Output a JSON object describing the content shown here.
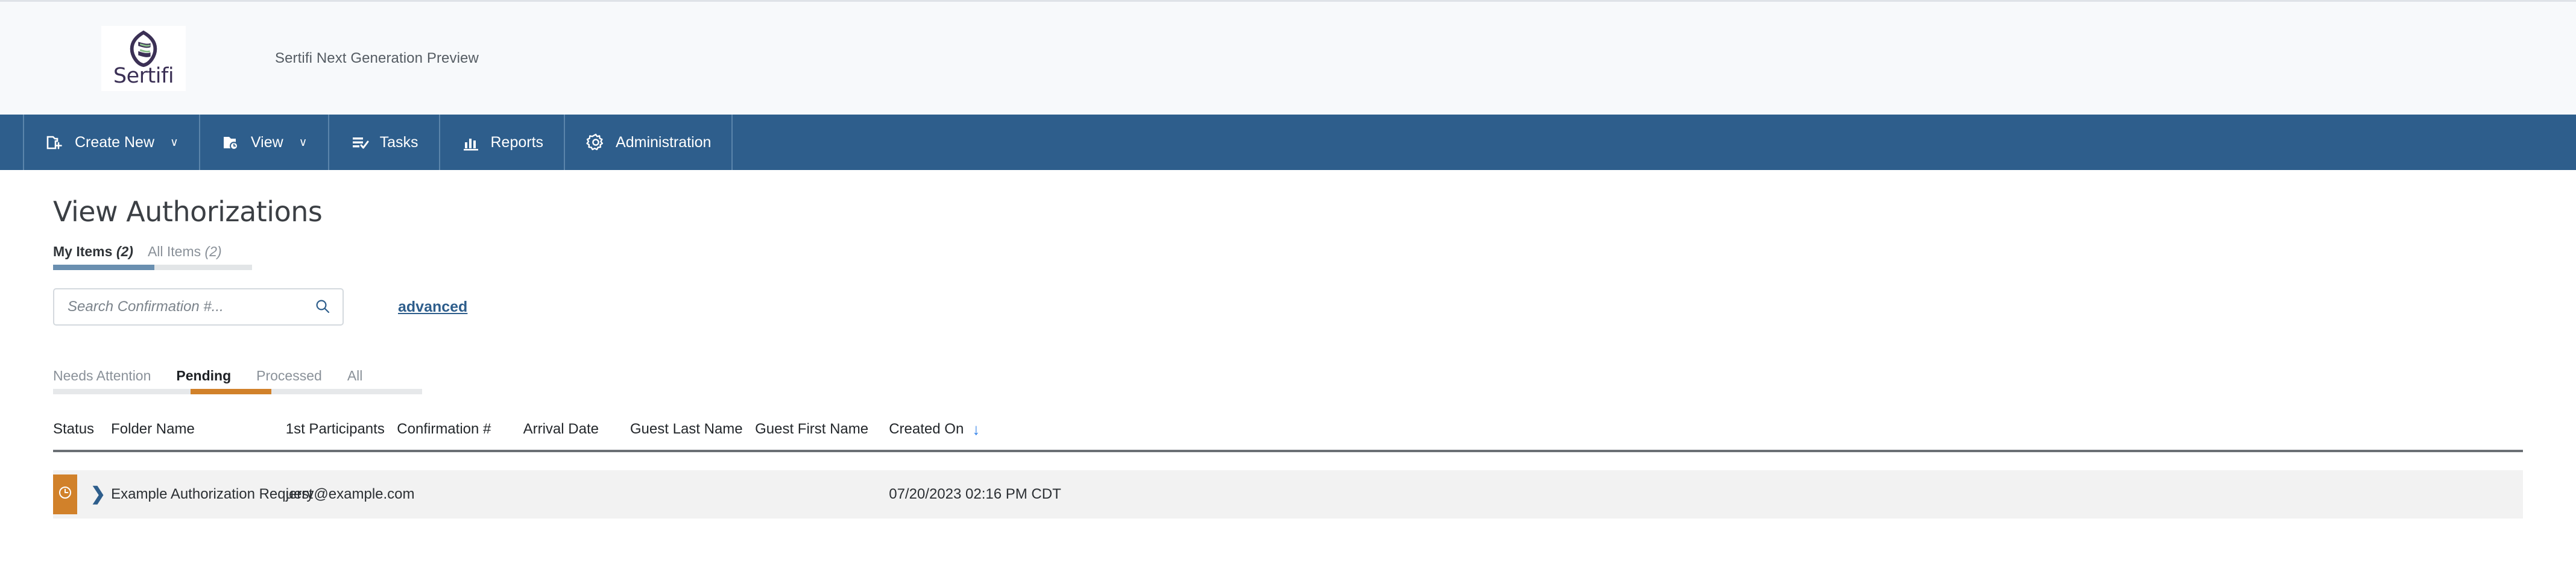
{
  "brand": {
    "logo_word": "Sertifi",
    "logo_icon": "sertifi-leaf-logo",
    "preview_text": "Sertifi Next Generation Preview"
  },
  "nav": {
    "items": [
      {
        "label": "Create New",
        "icon": "folder-plus-icon",
        "caret": "∨",
        "has_caret": true
      },
      {
        "label": "View",
        "icon": "folder-clock-icon",
        "caret": "∨",
        "has_caret": true
      },
      {
        "label": "Tasks",
        "icon": "list-check-icon",
        "has_caret": false
      },
      {
        "label": "Reports",
        "icon": "bar-chart-icon",
        "has_caret": false
      },
      {
        "label": "Administration",
        "icon": "gear-icon",
        "has_caret": false
      }
    ]
  },
  "page": {
    "title": "View Authorizations"
  },
  "scope_tabs": [
    {
      "label": "My Items",
      "count": "(2)",
      "active": true
    },
    {
      "label": "All Items",
      "count": "(2)",
      "active": false
    }
  ],
  "search": {
    "value": "",
    "placeholder": "Search Confirmation #...",
    "icon": "search-icon",
    "advanced_label": "advanced"
  },
  "filter_tabs": [
    {
      "label": "Needs Attention",
      "active": false
    },
    {
      "label": "Pending",
      "active": true
    },
    {
      "label": "Processed",
      "active": false
    },
    {
      "label": "All",
      "active": false
    }
  ],
  "table": {
    "columns": [
      {
        "label": "Status",
        "sorted": false
      },
      {
        "label": "Folder Name",
        "sorted": false
      },
      {
        "label": "1st Participants",
        "sorted": false
      },
      {
        "label": "Confirmation #",
        "sorted": false
      },
      {
        "label": "Arrival Date",
        "sorted": false
      },
      {
        "label": "Guest Last Name",
        "sorted": false
      },
      {
        "label": "Guest First Name",
        "sorted": false
      },
      {
        "label": "Created On",
        "sorted": true,
        "sort_direction": "↓"
      }
    ],
    "rows": [
      {
        "status_icon": "clock-icon",
        "status_color": "#d1812a",
        "expand_icon": "chevron-right-icon",
        "folder_name": "Example Authorization Request",
        "first_participants": "jerry@example.com",
        "confirmation_number": "",
        "arrival_date": "",
        "guest_last_name": "",
        "guest_first_name": "",
        "created_on": "07/20/2023 02:16 PM CDT"
      }
    ]
  },
  "colors": {
    "nav_blue": "#2e5e8c",
    "accent_orange": "#d1812a",
    "link_blue": "#2e5e8c",
    "sort_blue": "#2f7fe8",
    "logo_purple": "#3b3055"
  }
}
